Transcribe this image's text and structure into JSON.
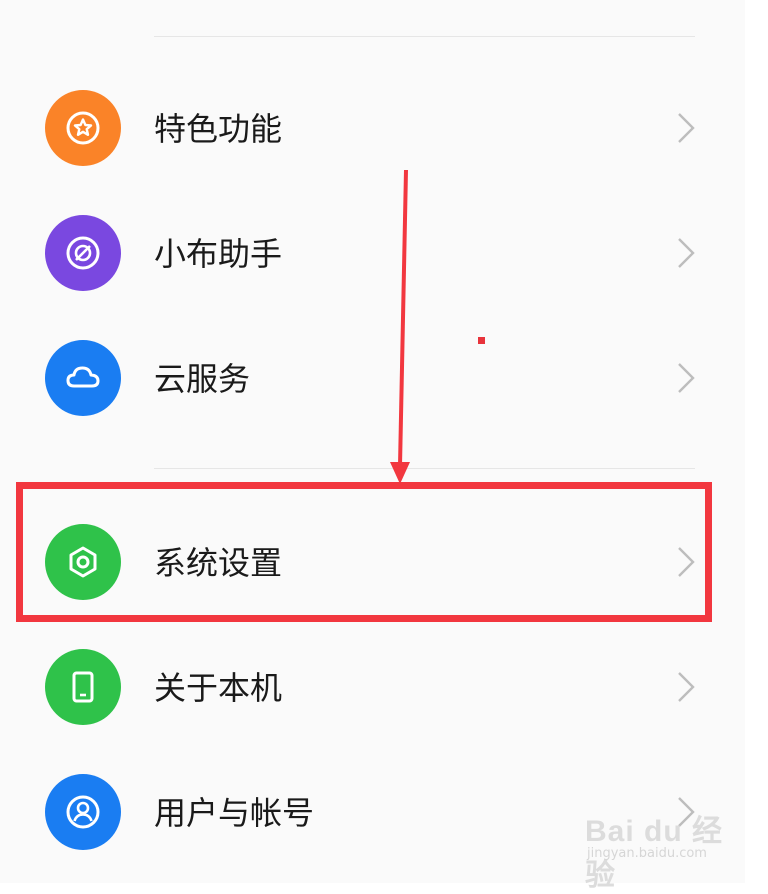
{
  "menu": {
    "items": [
      {
        "label": "特色功能",
        "icon": "star-icon",
        "color": "#fa8328"
      },
      {
        "label": "小布助手",
        "icon": "assistant-icon",
        "color": "#7a48e0"
      },
      {
        "label": "云服务",
        "icon": "cloud-icon",
        "color": "#1a7df2"
      },
      {
        "label": "系统设置",
        "icon": "settings-hexagon-icon",
        "color": "#2fc24a"
      },
      {
        "label": "关于本机",
        "icon": "phone-icon",
        "color": "#2fc24a"
      },
      {
        "label": "用户与帐号",
        "icon": "user-icon",
        "color": "#1a7df2"
      }
    ]
  },
  "annotation": {
    "highlight_color": "#f2373f",
    "highlighted_item": "系统设置"
  },
  "watermark": {
    "main": "Bai du 经验",
    "sub": "jingyan.baidu.com"
  }
}
